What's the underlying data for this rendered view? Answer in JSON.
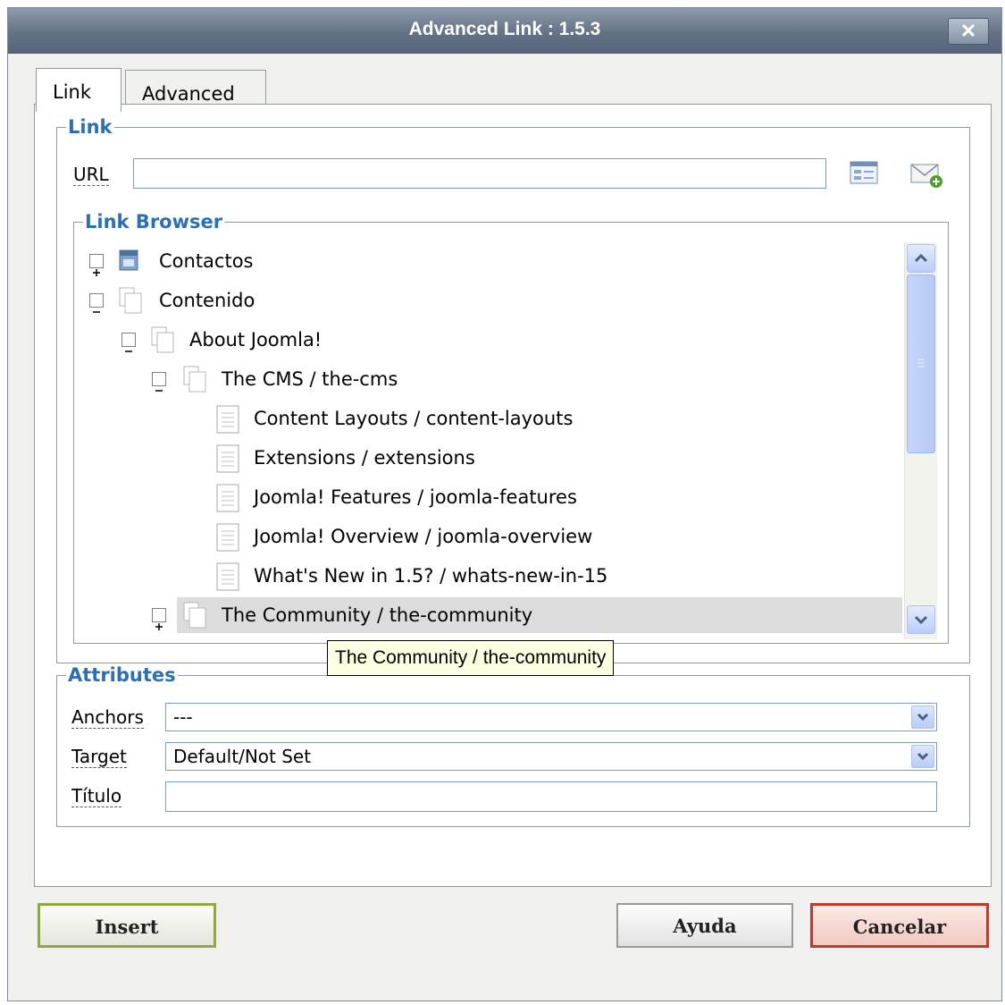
{
  "window": {
    "title": "Advanced Link : 1.5.3",
    "close_glyph": "✕"
  },
  "tabs": [
    {
      "label": "Link"
    },
    {
      "label": "Advanced"
    }
  ],
  "link_section": {
    "legend": "Link",
    "url_label": "URL",
    "url_value": ""
  },
  "browser": {
    "legend": "Link Browser",
    "items": [
      {
        "label": "Contactos",
        "toggle": "+",
        "icon": "contacts-icon"
      },
      {
        "label": "Contenido",
        "toggle": "−",
        "icon": "folder-icon"
      },
      {
        "label": "About Joomla!",
        "toggle": "−",
        "icon": "folder-icon"
      },
      {
        "label": "The CMS / the-cms",
        "toggle": "−",
        "icon": "folder-icon"
      },
      {
        "label": "Content Layouts / content-layouts",
        "icon": "document-icon"
      },
      {
        "label": "Extensions / extensions",
        "icon": "document-icon"
      },
      {
        "label": "Joomla! Features / joomla-features",
        "icon": "document-icon"
      },
      {
        "label": "Joomla! Overview / joomla-overview",
        "icon": "document-icon"
      },
      {
        "label": "What's New in 1.5? / whats-new-in-15",
        "icon": "document-icon"
      },
      {
        "label": "The Community / the-community",
        "toggle": "+",
        "icon": "folder-icon",
        "selected": true
      }
    ],
    "tooltip": "The Community / the-community"
  },
  "attributes": {
    "legend": "Attributes",
    "anchors_label": "Anchors",
    "anchors_value": "---",
    "target_label": "Target",
    "target_value": "Default/Not Set",
    "titulo_label": "Título",
    "titulo_value": ""
  },
  "buttons": {
    "insert": "Insert",
    "ayuda": "Ayuda",
    "cancelar": "Cancelar"
  },
  "colors": {
    "legend": "#2b6fb6",
    "titlebar": "#647387",
    "insert_border": "#8faa3c",
    "cancel_border": "#c0392b"
  }
}
